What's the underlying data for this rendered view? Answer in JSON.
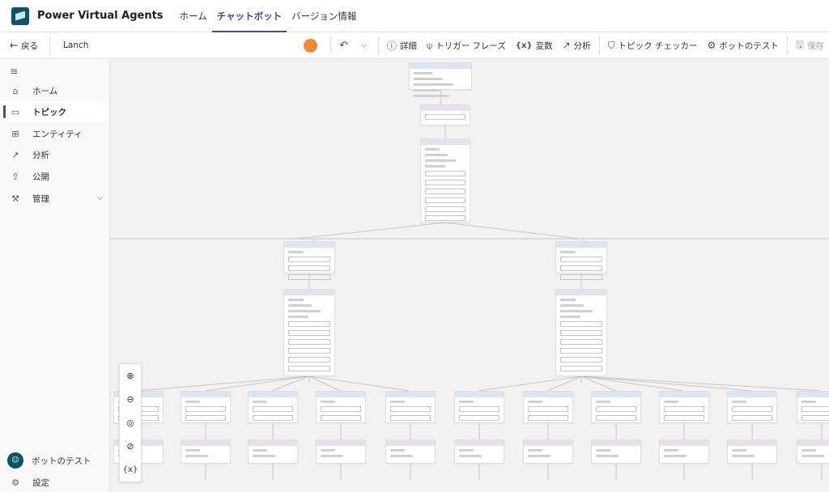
{
  "header": {
    "app_title": "Power Virtual Agents",
    "tabs": [
      {
        "label": "ホーム"
      },
      {
        "label": "チャットボット"
      },
      {
        "label": "バージョン情報"
      }
    ]
  },
  "toolbar": {
    "back_label": "戻る",
    "topic_name": "Lanch",
    "avatar_color": "#F7882F",
    "details_label": "詳細",
    "trigger_label": "トリガー フレーズ",
    "variables_label": "変数",
    "analytics_label": "分析",
    "checker_label": "トピック チェッカー",
    "test_label": "ボットのテスト",
    "save_label": "保存"
  },
  "sidebar": {
    "items": [
      {
        "label": "ホーム",
        "icon": "home-icon"
      },
      {
        "label": "トピック",
        "icon": "chat-icon"
      },
      {
        "label": "エンティティ",
        "icon": "entity-icon"
      },
      {
        "label": "分析",
        "icon": "chart-icon"
      },
      {
        "label": "公開",
        "icon": "upload-icon"
      },
      {
        "label": "管理",
        "icon": "wrench-icon"
      }
    ],
    "test_bot_label": "ボットのテスト",
    "settings_label": "設定"
  },
  "zoom": {
    "zoom_in": "zoom-in-icon",
    "zoom_out": "zoom-out-icon",
    "recenter": "target-icon",
    "reset": "reset-icon",
    "variables_glyph": "{x}"
  },
  "colors": {
    "accent": "#474B8F",
    "brand": "#0B556A",
    "canvas": "#F3F2F1"
  }
}
